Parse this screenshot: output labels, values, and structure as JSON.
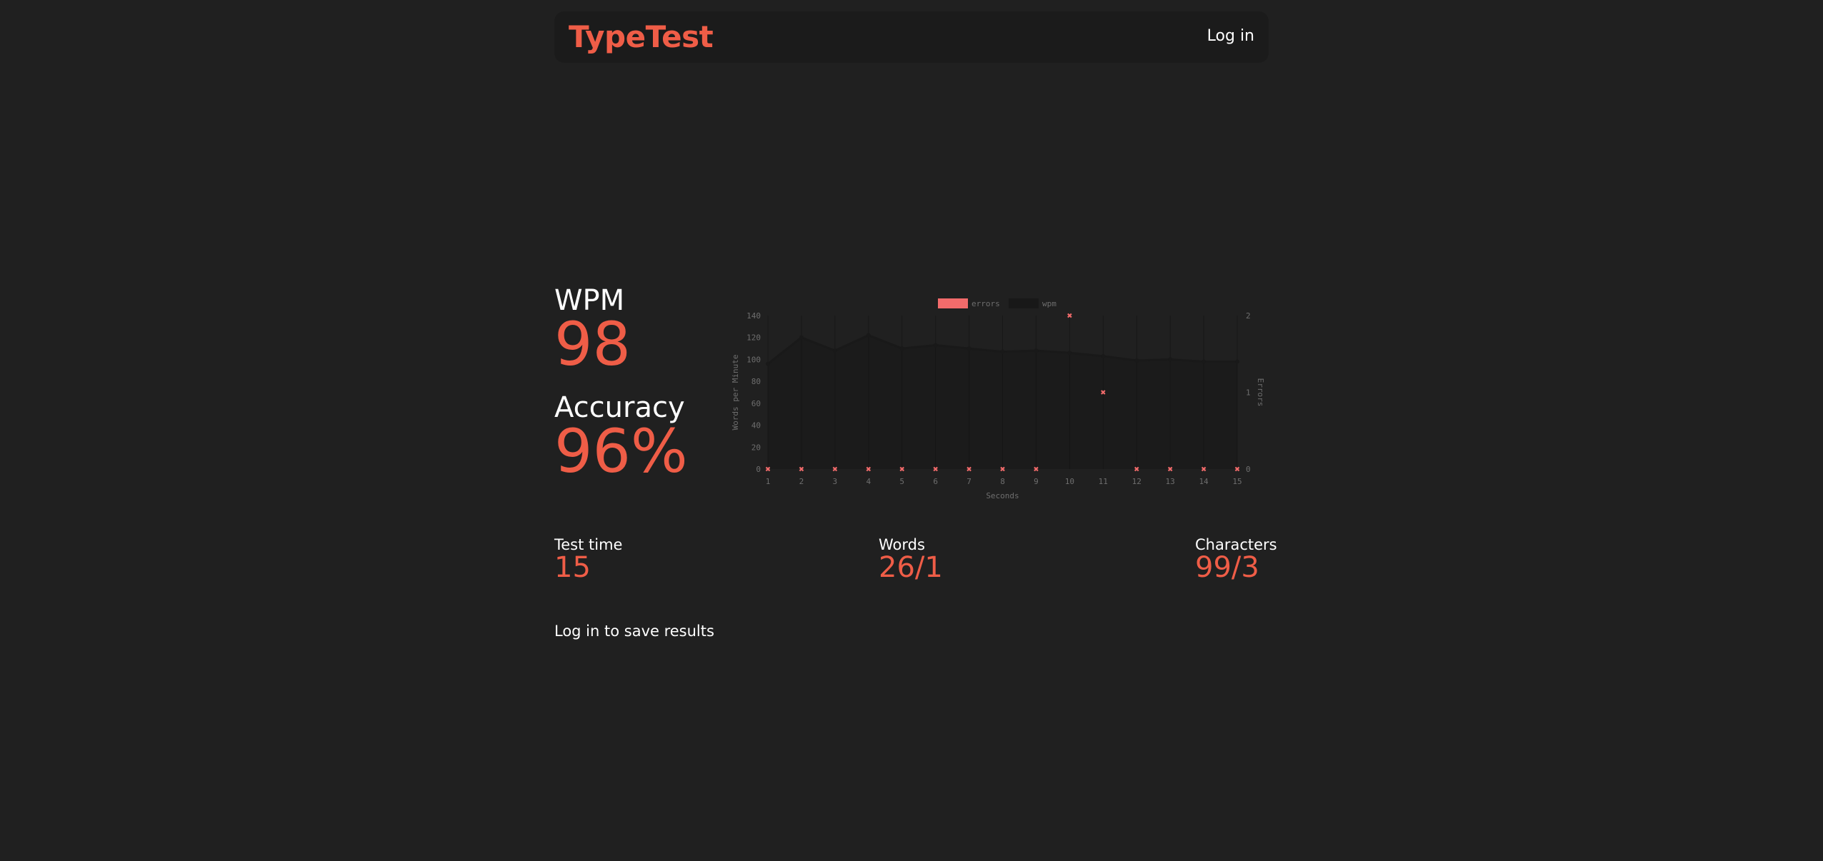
{
  "header": {
    "logo": "TypeTest",
    "login_label": "Log in"
  },
  "results": {
    "wpm_label": "WPM",
    "wpm_value": "98",
    "accuracy_label": "Accuracy",
    "accuracy_value": "96%",
    "test_time_label": "Test time",
    "test_time_value": "15",
    "words_label": "Words",
    "words_value": "26/1",
    "characters_label": "Characters",
    "characters_value": "99/3"
  },
  "save_prompt": "Log in to save results",
  "colors": {
    "accent": "#ef5d47",
    "background": "#202020",
    "header_bg": "#1b1b1b",
    "errors_series": "#f26b6b",
    "wpm_series": "#181818"
  },
  "chart_data": {
    "type": "line",
    "x": [
      1,
      2,
      3,
      4,
      5,
      6,
      7,
      8,
      9,
      10,
      11,
      12,
      13,
      14,
      15
    ],
    "xlabel": "Seconds",
    "ylabel": "Words per Minute",
    "y2label": "Errors",
    "ylim": [
      0,
      140
    ],
    "y2lim": [
      0,
      2
    ],
    "yticks": [
      "0",
      "20",
      "40",
      "60",
      "80",
      "100",
      "120",
      "140"
    ],
    "y2ticks": [
      "0",
      "1",
      "2"
    ],
    "xticks": [
      "1",
      "2",
      "3",
      "4",
      "5",
      "6",
      "7",
      "8",
      "9",
      "10",
      "11",
      "12",
      "13",
      "14",
      "15"
    ],
    "legend_position": "top",
    "grid": true,
    "series": [
      {
        "name": "errors",
        "axis": "right",
        "style": "scatter",
        "values": [
          0,
          0,
          0,
          0,
          0,
          0,
          0,
          0,
          0,
          2,
          1,
          0,
          0,
          0,
          0
        ]
      },
      {
        "name": "wpm",
        "axis": "left",
        "style": "line",
        "values": [
          96,
          120,
          108,
          122,
          110,
          113,
          110,
          107,
          108,
          106,
          103,
          99,
          100,
          98,
          98
        ]
      }
    ]
  }
}
